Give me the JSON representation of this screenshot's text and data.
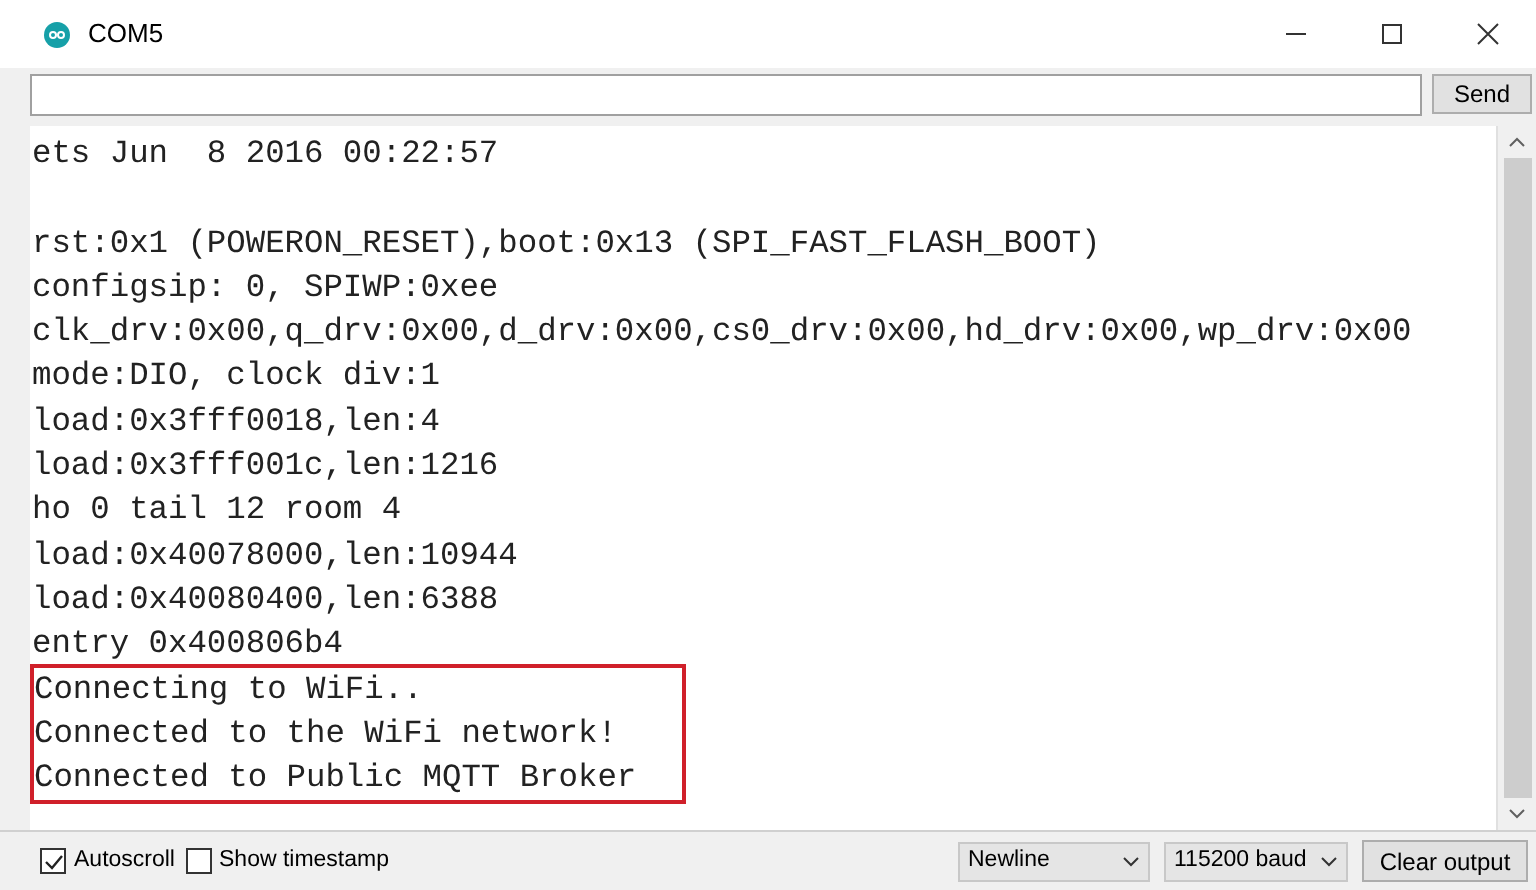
{
  "window": {
    "title": "COM5"
  },
  "send_button": "Send",
  "output_lines": [
    {
      "text": "ets Jun  8 2016 00:22:57",
      "highlighted": false
    },
    {
      "highlighted": false
    },
    {
      "text": "rst:0x1 (POWERON_RESET),boot:0x13 (SPI_FAST_FLASH_BOOT)",
      "highlighted": false
    },
    {
      "text": "configsip: 0, SPIWP:0xee",
      "highlighted": false
    },
    {
      "text": "clk_drv:0x00,q_drv:0x00,d_drv:0x00,cs0_drv:0x00,hd_drv:0x00,wp_drv:0x00",
      "highlighted": false
    },
    {
      "text": "mode:DIO, clock div:1",
      "highlighted": false
    },
    {
      "text": "load:0x3fff0018,len:4",
      "highlighted": false
    },
    {
      "text": "load:0x3fff001c,len:1216",
      "highlighted": false
    },
    {
      "text": "ho 0 tail 12 room 4",
      "highlighted": false
    },
    {
      "text": "load:0x40078000,len:10944",
      "highlighted": false
    },
    {
      "text": "load:0x40080400,len:6388",
      "highlighted": false
    },
    {
      "text": "entry 0x400806b4",
      "highlighted": false
    },
    {
      "text": "Connecting to WiFi..",
      "highlighted": true
    },
    {
      "text": "Connected to the WiFi network!",
      "highlighted": true
    },
    {
      "text": "Connected to Public MQTT Broker",
      "highlighted": true
    }
  ],
  "autoscroll": {
    "label": "Autoscroll",
    "checked": true
  },
  "timestamp": {
    "label": "Show timestamp",
    "checked": false
  },
  "line_ending": "Newline",
  "baud": "115200 baud",
  "clear_button": "Clear output"
}
